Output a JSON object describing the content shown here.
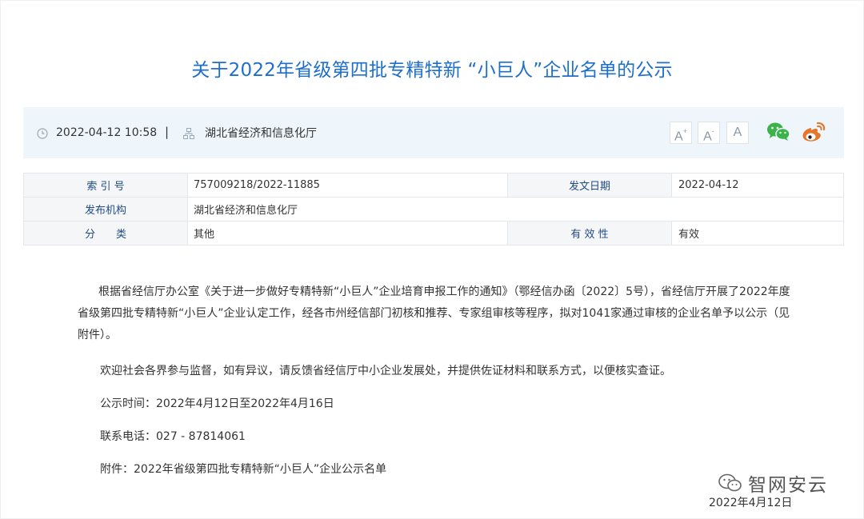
{
  "title": "关于2022年省级第四批专精特新 “小巨人”企业名单的公示",
  "meta": {
    "datetime": "2022-04-12 10:58",
    "separator": "|",
    "publisher": "湖北省经济和信息化厅",
    "font_large": "A",
    "font_small": "A",
    "font_reset": "A",
    "font_large_sup": "+",
    "font_small_sup": "-"
  },
  "info_table": {
    "index_label": "索 引 号",
    "index_value": "757009218/2022-11885",
    "date_label": "发文日期",
    "date_value": "2022-04-12",
    "org_label": "发布机构",
    "org_value": "湖北省经济和信息化厅",
    "category_label": "分　　类",
    "category_value": "其他",
    "validity_label": "有 效 性",
    "validity_value": "有效"
  },
  "body": {
    "paragraph1": "根据省经信厅办公室《关于进一步做好专精特新“小巨人”企业培育申报工作的通知》（鄂经信办函〔2022〕5号），省经信厅开展了2022年度省级第四批专精特新“小巨人”企业认定工作，经各市州经信部门初核和推荐、专家组审核等程序，拟对1041家通过审核的企业名单予以公示（见附件）。",
    "paragraph2": "欢迎社会各界参与监督，如有异议，请反馈省经信厅中小企业发展处，并提供佐证材料和联系方式，以便核实查证。",
    "period": "公示时间：2022年4月12日至2022年4月16日",
    "phone": "联系电话：027 - 87814061",
    "attachment": "附件：2022年省级第四批专精特新“小巨人”企业公示名单"
  },
  "watermark": {
    "text": "智网安云"
  },
  "footer_date": "2022年4月12日",
  "colors": {
    "title": "#1e6fcc",
    "label": "#1f4b86",
    "meta_bg": "#eef6fc",
    "wechat": "#3bb24a",
    "weibo": "#e6762b"
  }
}
